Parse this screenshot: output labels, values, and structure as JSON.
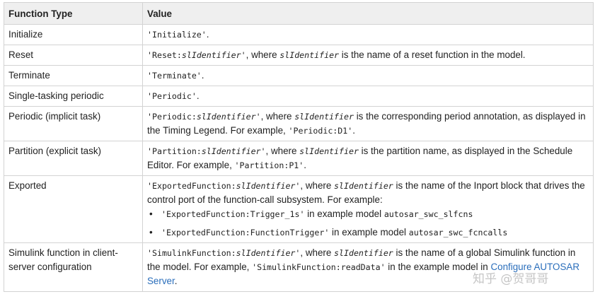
{
  "headers": {
    "col1": "Function Type",
    "col2": "Value"
  },
  "rows": {
    "r1": {
      "type": "Initialize",
      "code": "'Initialize'",
      "end": "."
    },
    "r2": {
      "type": "Reset",
      "code_a": "'Reset:",
      "code_var": "slIdentifier",
      "code_b": "'",
      "t1": ", where ",
      "var": "slIdentifier",
      "t2": " is the name of a reset function in the model."
    },
    "r3": {
      "type": "Terminate",
      "code": "'Terminate'",
      "end": "."
    },
    "r4": {
      "type": "Single-tasking periodic",
      "code": "'Periodic'",
      "end": "."
    },
    "r5": {
      "type": "Periodic (implicit task)",
      "code_a": "'Periodic:",
      "code_var": "slIdentifier",
      "code_b": "'",
      "t1": ", where ",
      "var": "slIdentifier",
      "t2": " is the corresponding period annotation, as displayed in the Timing Legend. For example, ",
      "example": "'Periodic:D1'",
      "end": "."
    },
    "r6": {
      "type": "Partition (explicit task)",
      "code_a": "'Partition:",
      "code_var": "slIdentifier",
      "code_b": "'",
      "t1": ", where ",
      "var": "slIdentifier",
      "t2": " is the partition name, as displayed in the Schedule Editor. For example, ",
      "example": "'Partition:P1'",
      "end": "."
    },
    "r7": {
      "type": "Exported",
      "code_a": "'ExportedFunction:",
      "code_var": "slIdentifier",
      "code_b": "'",
      "t1": ", where ",
      "var": "slIdentifier",
      "t2": " is the name of the Inport block that drives the control port of the function-call subsystem. For example:",
      "bullets": [
        {
          "code": "'ExportedFunction:Trigger_1s'",
          "text": " in example model ",
          "model": "autosar_swc_slfcns"
        },
        {
          "code": "'ExportedFunction:FunctionTrigger'",
          "text": " in example model ",
          "model": "autosar_swc_fcncalls"
        }
      ]
    },
    "r8": {
      "type": "Simulink function in client-server configuration",
      "code_a": "'SimulinkFunction:",
      "code_var": "slIdentifier",
      "code_b": "'",
      "t1": ", where ",
      "var": "slIdentifier",
      "t2": " is the name of a global Simulink function in the model. For example, ",
      "example": "'SimulinkFunction:readData'",
      "t3": " in the example model in ",
      "link": "Configure AUTOSAR Server",
      "end": "."
    }
  },
  "watermark": "知乎 @贺哥哥"
}
